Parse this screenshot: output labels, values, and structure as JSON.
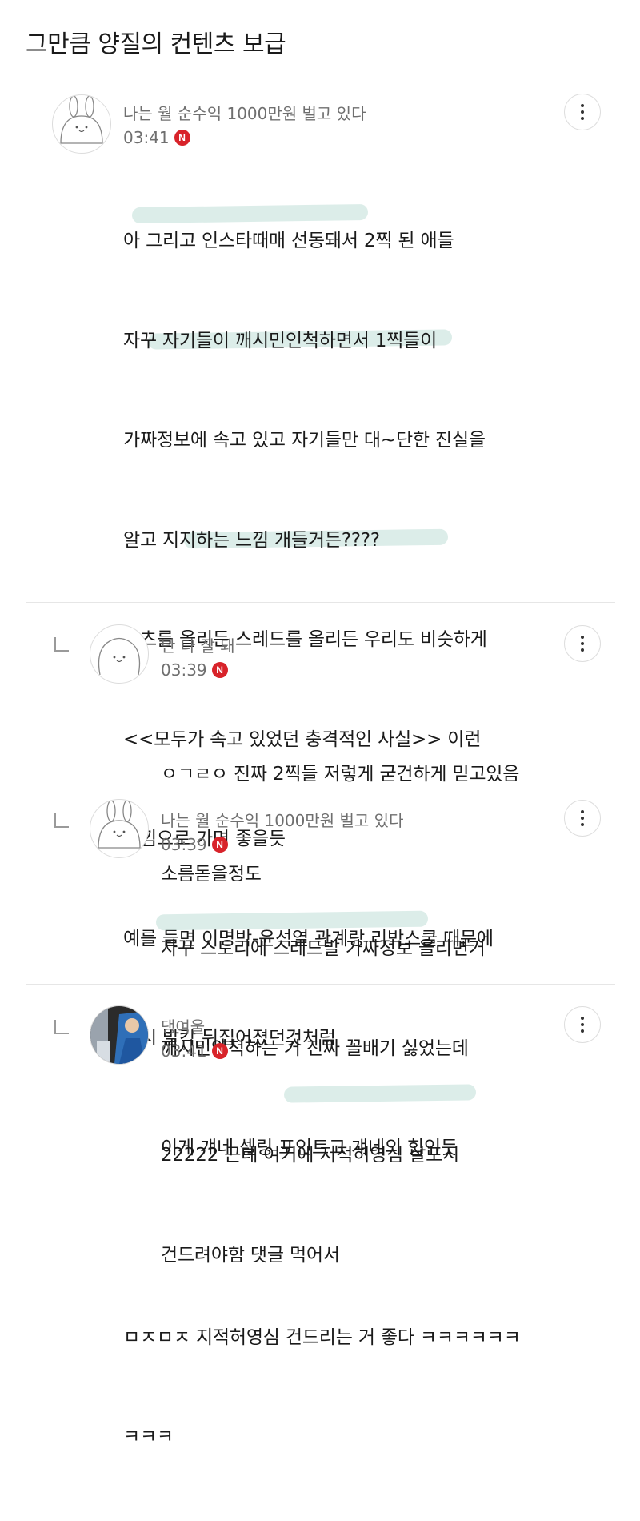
{
  "page": {
    "title": "그만큼 양질의 컨텐츠 보급"
  },
  "comments": [
    {
      "author": "나는 월 순수익 1000만원 벌고 있다",
      "time": "03:41",
      "badge": "N",
      "avatar_icon": "rabbit-avatar-icon",
      "is_reply": false,
      "lines": [
        "아 그리고 인스타때매 선동돼서 2찍 된 애들",
        "자꾸 자기들이 깨시민인척하면서 1찍들이",
        "가짜정보에 속고 있고 자기들만 대~단한 진실을",
        "알고 지지하는 느낌 개들거든????",
        "쇼츠를 올리든 스레드를 올리든 우리도 비슷하게",
        "<<모두가 속고 있었던 충격적인 사실>> 이런",
        "느낌으로 가면 좋을듯",
        "예를 들면 이명박-윤석열 관계랑 리박스쿨 때문에",
        "여시 발칵 뒤집어졌던것처럼",
        "",
        "",
        "ㅁㅈㅁㅈ 지적허영심 건드리는 거 좋다 ㅋㅋㅋㅋㅋㅋ",
        "ㅋㅋㅋ"
      ]
    },
    {
      "author": "난 다 잘 돼",
      "time": "03:39",
      "badge": "N",
      "avatar_icon": "blob-avatar-icon",
      "is_reply": true,
      "lines": [
        "ㅇㄱㄹㅇ 진짜 2찍들 저렇게 굳건하게 믿고있음",
        "소름돋을정도"
      ]
    },
    {
      "author": "나는 월 순수익 1000만원 벌고 있다",
      "time": "03:39",
      "badge": "N",
      "avatar_icon": "rabbit-avatar-icon",
      "is_reply": true,
      "lines": [
        "자꾸 스토리에 스레드발 가짜정보 올리면거",
        "깨시민인척하는 거 진짜 꼴배기 싫었는데",
        "이게 걔네 셀링 포인트고 걔네의 힙인듯"
      ]
    },
    {
      "author": "댕여울",
      "time": "03:41",
      "badge": "N",
      "avatar_icon": "photo-avatar-icon",
      "is_reply": true,
      "lines": [
        "22222 근데 여기에 지적허영심 살포시",
        "건드려야함 댓글 먹어서"
      ]
    }
  ],
  "colors": {
    "badge": "#d8232a",
    "highlight": "#c9e4dd",
    "meta_text": "#6f6f6f"
  }
}
